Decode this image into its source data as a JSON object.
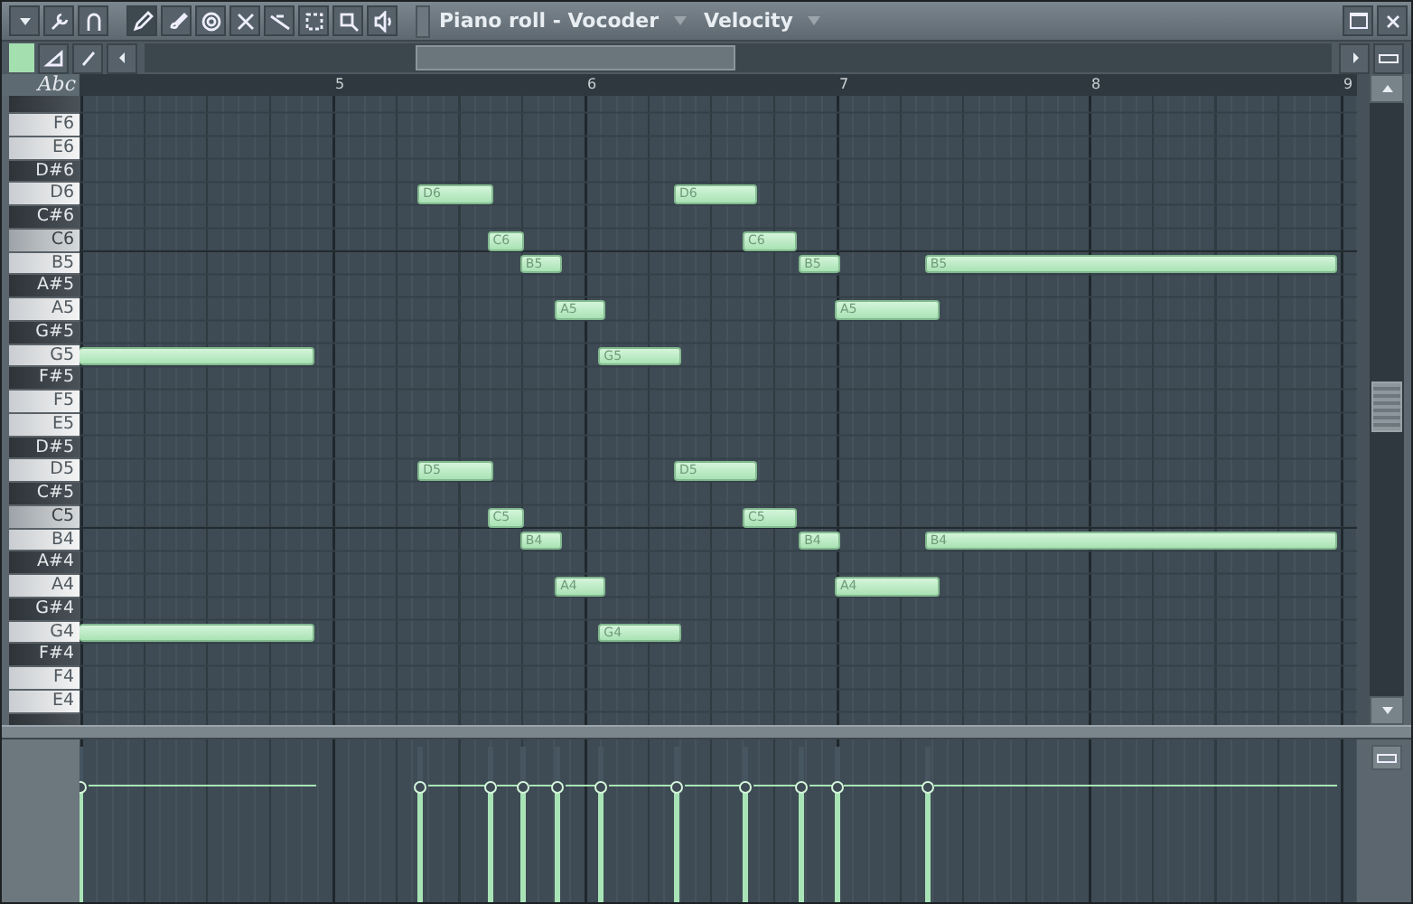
{
  "window": {
    "title": "Piano roll - Vocoder",
    "target": "Velocity"
  },
  "tools": [
    {
      "kind": "pencil",
      "selected": true
    },
    {
      "kind": "brush",
      "selected": false
    },
    {
      "kind": "erase",
      "selected": false
    },
    {
      "kind": "mute",
      "selected": false
    },
    {
      "kind": "slice",
      "selected": false
    },
    {
      "kind": "select",
      "selected": false
    },
    {
      "kind": "zoom",
      "selected": false
    },
    {
      "kind": "speaker",
      "selected": false
    }
  ],
  "abc_label": "Abc",
  "ruler": [
    "5",
    "6",
    "7",
    "8",
    "9"
  ],
  "keys": [
    {
      "kind": "black"
    },
    {
      "label": "F6",
      "kind": "white"
    },
    {
      "label": "E6",
      "kind": "white"
    },
    {
      "label": "D#6",
      "kind": "black"
    },
    {
      "label": "D6",
      "kind": "white"
    },
    {
      "label": "C#6",
      "kind": "black"
    },
    {
      "label": "C6",
      "kind": "c"
    },
    {
      "label": "B5",
      "kind": "white"
    },
    {
      "label": "A#5",
      "kind": "black"
    },
    {
      "label": "A5",
      "kind": "white"
    },
    {
      "label": "G#5",
      "kind": "black"
    },
    {
      "label": "G5",
      "kind": "white"
    },
    {
      "label": "F#5",
      "kind": "black"
    },
    {
      "label": "F5",
      "kind": "white"
    },
    {
      "label": "E5",
      "kind": "white"
    },
    {
      "label": "D#5",
      "kind": "black"
    },
    {
      "label": "D5",
      "kind": "white"
    },
    {
      "label": "C#5",
      "kind": "black"
    },
    {
      "label": "C5",
      "kind": "c"
    },
    {
      "label": "B4",
      "kind": "white"
    },
    {
      "label": "A#4",
      "kind": "black"
    },
    {
      "label": "A4",
      "kind": "white"
    },
    {
      "label": "G#4",
      "kind": "black"
    },
    {
      "label": "G4",
      "kind": "white"
    },
    {
      "label": "F#4",
      "kind": "black"
    },
    {
      "label": "F4",
      "kind": "white"
    },
    {
      "label": "E4",
      "kind": "white"
    },
    {
      "kind": "black"
    }
  ],
  "notes": [
    {
      "clipped": true
    },
    {
      "clipped": true
    },
    {
      "label": "D6",
      "clipped": false
    },
    {
      "label": "D5",
      "clipped": false
    },
    {
      "label": "C6",
      "clipped": false
    },
    {
      "label": "C5",
      "clipped": false
    },
    {
      "label": "B5",
      "clipped": false
    },
    {
      "label": "B4",
      "clipped": false
    },
    {
      "label": "A5",
      "clipped": false
    },
    {
      "label": "A4",
      "clipped": false
    },
    {
      "label": "G5",
      "clipped": false
    },
    {
      "label": "G4",
      "clipped": false
    },
    {
      "label": "D6",
      "clipped": false
    },
    {
      "label": "D5",
      "clipped": false
    },
    {
      "label": "C6",
      "clipped": false
    },
    {
      "label": "C5",
      "clipped": false
    },
    {
      "label": "B5",
      "clipped": false
    },
    {
      "label": "B4",
      "clipped": false
    },
    {
      "label": "A5",
      "clipped": false
    },
    {
      "label": "A4",
      "clipped": false
    },
    {
      "label": "B5",
      "clipped": false
    },
    {
      "label": "B4",
      "clipped": false
    }
  ],
  "velocities": [
    {
      "level": 0.74
    },
    {
      "level": 0.74
    },
    {
      "level": 0.74
    },
    {
      "level": 0.74
    },
    {
      "level": 0.74
    },
    {
      "level": 0.74
    },
    {
      "level": 0.74
    },
    {
      "level": 0.74
    },
    {
      "level": 0.74
    },
    {
      "level": 0.74
    },
    {
      "level": 0.74
    }
  ]
}
